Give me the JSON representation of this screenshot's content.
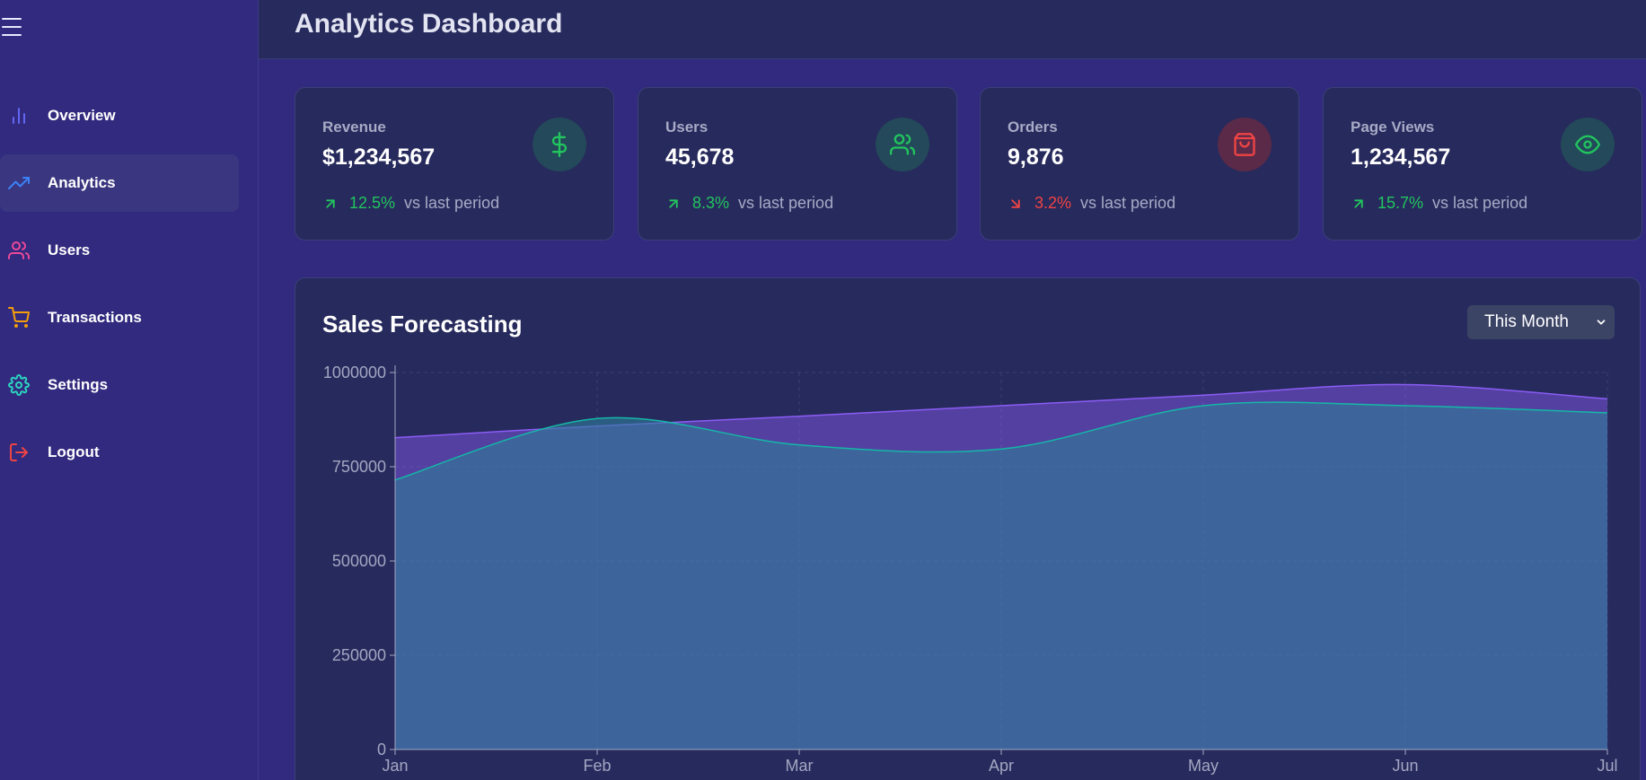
{
  "sidebar": {
    "menu_icon": "hamburger-icon",
    "items": [
      {
        "label": "Overview",
        "icon": "bar-chart-icon",
        "color": "#6366f1"
      },
      {
        "label": "Analytics",
        "icon": "trending-up-icon",
        "color": "#3b82f6",
        "active": true
      },
      {
        "label": "Users",
        "icon": "users-icon",
        "color": "#ec4899"
      },
      {
        "label": "Transactions",
        "icon": "cart-icon",
        "color": "#f59e0b"
      },
      {
        "label": "Settings",
        "icon": "gear-icon",
        "color": "#2dd4bf"
      },
      {
        "label": "Logout",
        "icon": "logout-icon",
        "color": "#ef4444"
      }
    ]
  },
  "header": {
    "title": "Analytics Dashboard"
  },
  "stats": [
    {
      "label": "Revenue",
      "value": "$1,234,567",
      "change": "12.5%",
      "direction": "up",
      "compare": "vs last period",
      "icon": "dollar-icon"
    },
    {
      "label": "Users",
      "value": "45,678",
      "change": "8.3%",
      "direction": "up",
      "compare": "vs last period",
      "icon": "users-icon"
    },
    {
      "label": "Orders",
      "value": "9,876",
      "change": "3.2%",
      "direction": "down",
      "compare": "vs last period",
      "icon": "shopping-bag-icon"
    },
    {
      "label": "Page Views",
      "value": "1,234,567",
      "change": "15.7%",
      "direction": "up",
      "compare": "vs last period",
      "icon": "eye-icon"
    }
  ],
  "colors": {
    "up": "#22c55e",
    "down": "#ef4444",
    "series_forecast": "#8b5cf6",
    "series_actual": "#14b8a6"
  },
  "forecast_panel": {
    "title": "Sales Forecasting",
    "period_select": "This Month"
  },
  "chart_data": {
    "type": "area",
    "x": [
      "Jan",
      "Feb",
      "Mar",
      "Apr",
      "May",
      "Jun",
      "Jul"
    ],
    "series": [
      {
        "values": [
          827000,
          858000,
          884000,
          912000,
          940000,
          968000,
          930000
        ]
      },
      {
        "values": [
          715000,
          878000,
          808000,
          797000,
          912000,
          912000,
          893000
        ]
      }
    ],
    "ylim": [
      0,
      1000000
    ],
    "yticks": [
      "0",
      "250000",
      "500000",
      "750000",
      "1000000"
    ],
    "grid": true
  }
}
